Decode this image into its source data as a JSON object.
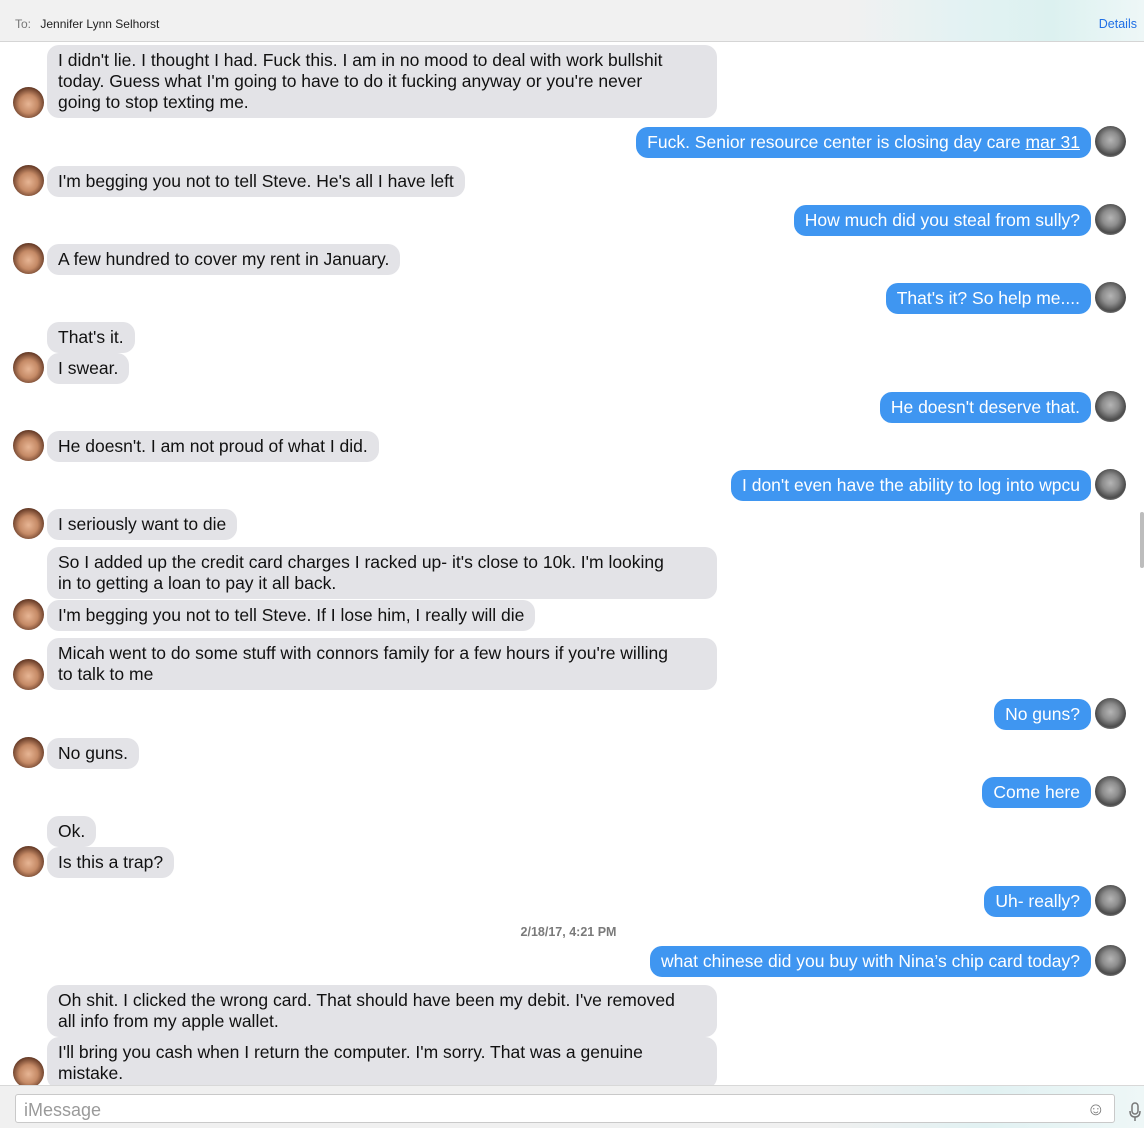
{
  "header": {
    "to_label": "To:",
    "recipient": "Jennifer Lynn Selhorst",
    "details_label": "Details"
  },
  "messages": [
    {
      "from": "her",
      "lines": [
        "I didn't lie. I thought I had. Fuck this. I am in no mood to deal with work bullshit",
        "today. Guess what I'm going to have to do it fucking anyway or you're never",
        "going to stop texting me."
      ]
    },
    {
      "from": "me",
      "text": "Fuck. Senior resource center is closing day care ",
      "link": "mar 31"
    },
    {
      "from": "her",
      "text": "I'm begging you not to tell Steve. He's all I have left"
    },
    {
      "from": "me",
      "text": "How much did you steal from sully?"
    },
    {
      "from": "her",
      "text": "A few hundred to cover my rent in January."
    },
    {
      "from": "me",
      "text": "That's it? So help me...."
    },
    {
      "from": "her",
      "text": "That's it."
    },
    {
      "from": "her",
      "text": "I swear."
    },
    {
      "from": "me",
      "text": "He doesn't deserve that."
    },
    {
      "from": "her",
      "text": "He doesn't. I am not proud of what I did."
    },
    {
      "from": "me",
      "text": "I don't even have the ability to log into wpcu"
    },
    {
      "from": "her",
      "text": "I seriously want to die"
    },
    {
      "from": "her",
      "lines": [
        "So I added up the credit card charges I racked up- it's close to 10k. I'm looking",
        "in to getting a loan to pay it all back."
      ]
    },
    {
      "from": "her",
      "text": "I'm begging you not to tell Steve. If I lose him, I really will die"
    },
    {
      "from": "her",
      "lines": [
        "Micah went to do some stuff with connors family for a few hours if you're willing",
        "to talk to me"
      ]
    },
    {
      "from": "me",
      "text": "No guns?"
    },
    {
      "from": "her",
      "text": "No guns."
    },
    {
      "from": "me",
      "text": "Come here"
    },
    {
      "from": "her",
      "text": "Ok."
    },
    {
      "from": "her",
      "text": "Is this a trap?"
    },
    {
      "from": "me",
      "text": "Uh- really?"
    },
    {
      "from": "me",
      "text": "what chinese did you buy with Nina’s chip card today?"
    },
    {
      "from": "her",
      "lines": [
        "Oh shit. I clicked the wrong card. That should have been my debit. I've removed",
        "all info from my apple wallet."
      ]
    },
    {
      "from": "her",
      "lines": [
        "I'll bring you cash when I return the computer. I'm sorry. That was a genuine",
        "mistake."
      ]
    }
  ],
  "timestamp": "2/18/17, 4:21 PM",
  "composer": {
    "placeholder": "iMessage"
  },
  "icons": {
    "emoji": "smiley-icon",
    "mic": "microphone-icon"
  },
  "colors": {
    "outgoing_bubble": "#3f96f1",
    "incoming_bubble": "#e3e3e7",
    "link": "#1f6fe5"
  }
}
